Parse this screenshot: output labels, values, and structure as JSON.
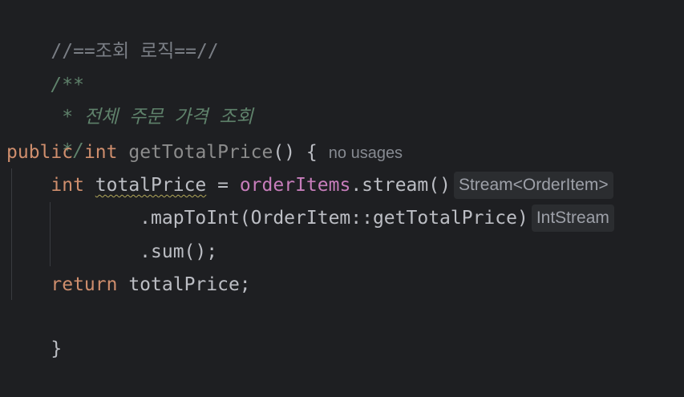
{
  "editor": {
    "lines": {
      "l1": {
        "comment": "//==조회 로직==//"
      },
      "l2": {
        "doc_open": "/**"
      },
      "l3": {
        "doc_text": " * 전체 주문 가격 조회"
      },
      "l4": {
        "doc_close": " */"
      },
      "l5": {
        "kw_public": "public",
        "kw_int": "int",
        "method": "getTotalPrice",
        "parens": "() {",
        "usages": "no usages"
      },
      "l6": {
        "kw_int": "int",
        "var": "totalPrice",
        "assign": " = ",
        "field": "orderItems",
        "call": ".stream()",
        "hint": "Stream<OrderItem>"
      },
      "l7": {
        "call": ".mapToInt(OrderItem::getTotalPrice)",
        "hint": "IntStream"
      },
      "l8": {
        "call": ".sum();"
      },
      "l9": {
        "kw_return": "return",
        "rest": " totalPrice;"
      },
      "l10": {
        "brace": "}"
      }
    }
  },
  "colors": {
    "background": "#1e1f22",
    "comment": "#7a7e85",
    "doc_comment": "#5f826b",
    "keyword": "#cf8e6d",
    "field": "#c77dbb",
    "text": "#bcbec4",
    "inlay_hint_bg": "#2b2d30"
  }
}
